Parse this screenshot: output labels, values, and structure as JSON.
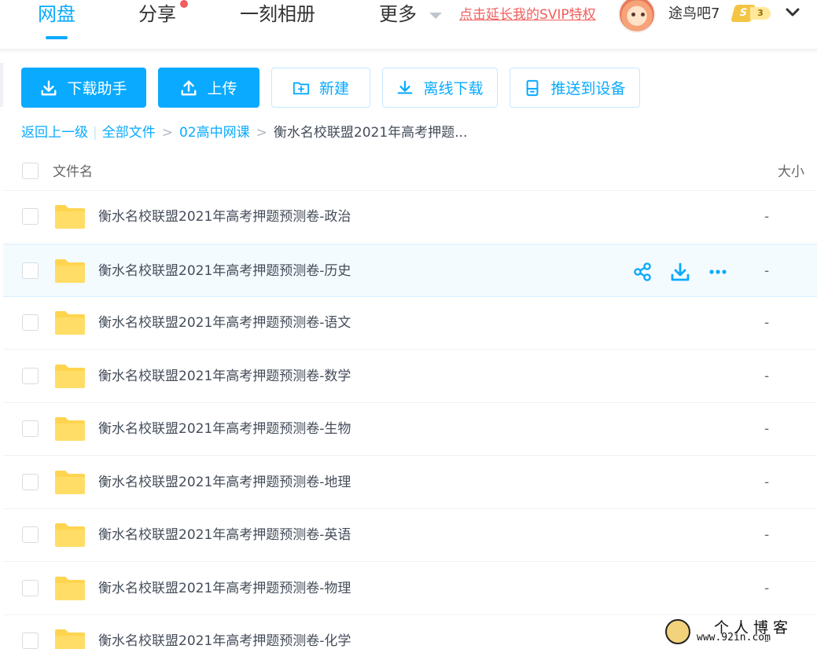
{
  "nav": {
    "tabs": [
      {
        "label": "网盘"
      },
      {
        "label": "分享"
      },
      {
        "label": "一刻相册"
      },
      {
        "label": "更多"
      }
    ],
    "svip_link": "点击延长我的SVIP特权",
    "username": "途鸟吧7",
    "level_symbol": "S",
    "level": "3"
  },
  "toolbar": {
    "download_helper": "下载助手",
    "upload": "上传",
    "new": "新建",
    "offline_download": "离线下载",
    "push_to_device": "推送到设备"
  },
  "breadcrumb": {
    "back": "返回上一级",
    "all_files": "全部文件",
    "folder": "02高中网课",
    "current": "衡水名校联盟2021年高考押题..."
  },
  "table": {
    "col_name": "文件名",
    "col_size": "大小",
    "rows": [
      {
        "name": "衡水名校联盟2021年高考押题预测卷-政治",
        "size": "-"
      },
      {
        "name": "衡水名校联盟2021年高考押题预测卷-历史",
        "size": "-"
      },
      {
        "name": "衡水名校联盟2021年高考押题预测卷-语文",
        "size": "-"
      },
      {
        "name": "衡水名校联盟2021年高考押题预测卷-数学",
        "size": "-"
      },
      {
        "name": "衡水名校联盟2021年高考押题预测卷-生物",
        "size": "-"
      },
      {
        "name": "衡水名校联盟2021年高考押题预测卷-地理",
        "size": "-"
      },
      {
        "name": "衡水名校联盟2021年高考押题预测卷-英语",
        "size": "-"
      },
      {
        "name": "衡水名校联盟2021年高考押题预测卷-物理",
        "size": "-"
      },
      {
        "name": "衡水名校联盟2021年高考押题预测卷-化学",
        "size": "-"
      }
    ]
  },
  "watermark": {
    "title": "个人博客",
    "url": "www.92in.com"
  },
  "colors": {
    "accent": "#09aaff",
    "folder": "#ffd44f",
    "alert": "#f25d5d"
  }
}
